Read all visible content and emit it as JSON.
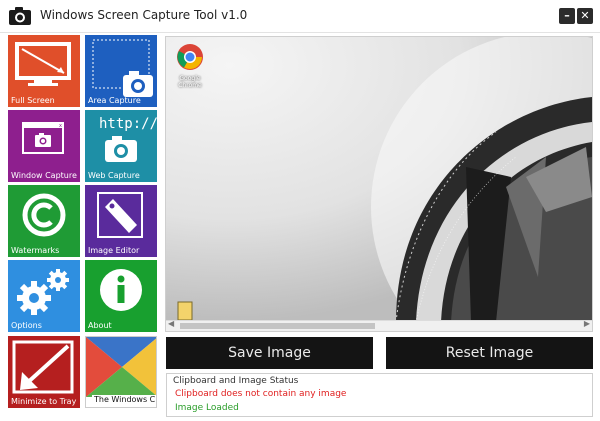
{
  "app": {
    "title": "Windows Screen Capture Tool v1.0"
  },
  "window_controls": {
    "minimize": "–",
    "close": "✕"
  },
  "tiles": [
    {
      "label": "Full Screen",
      "color": "#e04f2a",
      "icon": "monitor-icon"
    },
    {
      "label": "Area Capture",
      "color": "#1e5fbf",
      "icon": "area-camera-icon"
    },
    {
      "label": "Window Capture",
      "color": "#8e1f8e",
      "icon": "window-camera-icon"
    },
    {
      "label": "Web Capture",
      "color": "#1e8fa6",
      "icon": "web-camera-icon"
    },
    {
      "label": "Watermarks",
      "color": "#1f9b35",
      "icon": "copyright-icon"
    },
    {
      "label": "Image Editor",
      "color": "#5a2b9c",
      "icon": "image-editor-icon"
    },
    {
      "label": "Options",
      "color": "#2f8fe0",
      "icon": "gears-icon"
    },
    {
      "label": "About",
      "color": "#18a02f",
      "icon": "info-icon"
    },
    {
      "label": "Minimize to Tray",
      "color": "#b51f1f",
      "icon": "minimize-arrow-icon"
    },
    {
      "label": "The Windows Club",
      "color": "#ffffff",
      "icon": "windows-club-logo"
    }
  ],
  "web_capture_text": "http://",
  "preview": {
    "shortcut_label": "Google Chrome"
  },
  "buttons": {
    "save": "Save Image",
    "reset": "Reset Image"
  },
  "status": {
    "title": "Clipboard and Image Status",
    "clipboard_message": "Clipboard does not contain any image",
    "clipboard_color": "#e02020",
    "image_message": "Image Loaded",
    "image_color": "#2a9d2a"
  }
}
